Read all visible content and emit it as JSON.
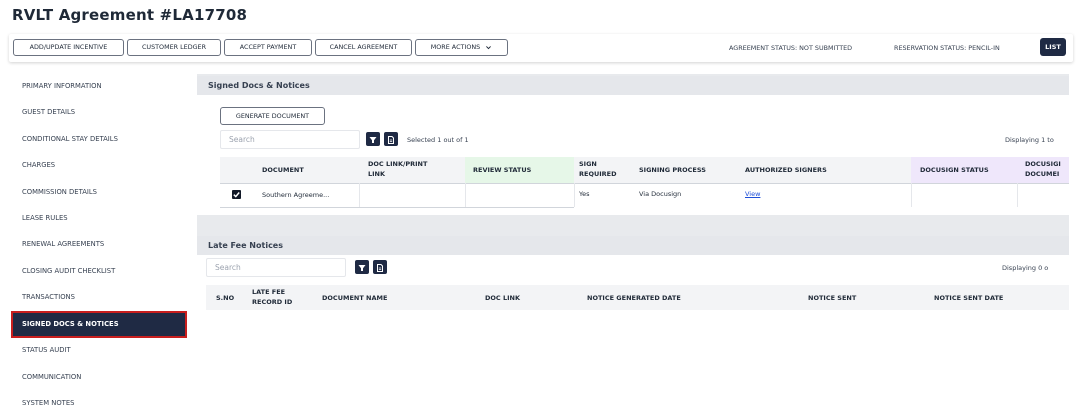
{
  "header": {
    "title": "RVLT Agreement #LA17708"
  },
  "toolbar": {
    "add_update_incentive": "ADD/UPDATE INCENTIVE",
    "customer_ledger": "CUSTOMER LEDGER",
    "accept_payment": "ACCEPT PAYMENT",
    "cancel_agreement": "CANCEL AGREEMENT",
    "more_actions": "MORE ACTIONS",
    "agreement_status": "AGREEMENT STATUS: NOT SUBMITTED",
    "reservation_status": "RESERVATION STATUS: PENCIL-IN",
    "list": "LIST"
  },
  "sidebar": {
    "items": [
      {
        "label": "PRIMARY INFORMATION"
      },
      {
        "label": "GUEST DETAILS"
      },
      {
        "label": "CONDITIONAL STAY DETAILS"
      },
      {
        "label": "CHARGES"
      },
      {
        "label": "COMMISSION DETAILS"
      },
      {
        "label": "LEASE RULES"
      },
      {
        "label": "RENEWAL AGREEMENTS"
      },
      {
        "label": "CLOSING AUDIT CHECKLIST"
      },
      {
        "label": "TRANSACTIONS"
      },
      {
        "label": "SIGNED DOCS & NOTICES"
      },
      {
        "label": "STATUS AUDIT"
      },
      {
        "label": "COMMUNICATION"
      },
      {
        "label": "SYSTEM NOTES"
      }
    ],
    "active": "SIGNED DOCS & NOTICES"
  },
  "signed_docs": {
    "title": "Signed Docs & Notices",
    "generate_button": "GENERATE DOCUMENT",
    "search_placeholder": "Search",
    "selected_text": "Selected 1 out of 1",
    "displaying_text": "Displaying 1 to",
    "columns": {
      "document": "DOCUMENT",
      "doc_link_1": "DOC LINK/PRINT",
      "doc_link_2": "LINK",
      "review_status": "REVIEW STATUS",
      "sign_required_1": "SIGN",
      "sign_required_2": "REQUIRED",
      "signing_process": "SIGNING PROCESS",
      "authorized_signers": "AUTHORIZED SIGNERS",
      "docusign_status": "DOCUSIGN STATUS",
      "docusign_document_1": "DOCUSIGI",
      "docusign_document_2": "DOCUMEI"
    },
    "rows": [
      {
        "checked": true,
        "document": "Southern Agreeme...",
        "doc_link": "",
        "review_status": "",
        "sign_required": "Yes",
        "signing_process": "Via Docusign",
        "authorized_signers": "View",
        "docusign_status": "",
        "docusign_document": ""
      }
    ],
    "colors": {
      "review_header_bg": "#e6f7e8",
      "docusign_header_bg": "#efe7fb",
      "link": "#1d4ed8"
    }
  },
  "late_fee": {
    "title": "Late Fee Notices",
    "search_placeholder": "Search",
    "displaying_text": "Displaying 0 o",
    "columns": {
      "sno": "S.NO",
      "late_fee_record_1": "LATE FEE",
      "late_fee_record_2": "RECORD ID",
      "document_name": "DOCUMENT NAME",
      "doc_link": "DOC LINK",
      "notice_generated_date": "NOTICE GENERATED DATE",
      "notice_sent": "NOTICE SENT",
      "notice_sent_date": "NOTICE SENT DATE"
    }
  },
  "icons": {
    "filter": "filter-icon",
    "export": "document-icon",
    "chevron": "chevron-down-icon",
    "check": "check-icon"
  },
  "colors": {
    "navy": "#1f2a44",
    "active_border": "#c81e1e",
    "panel_header": "#e5e7eb"
  }
}
